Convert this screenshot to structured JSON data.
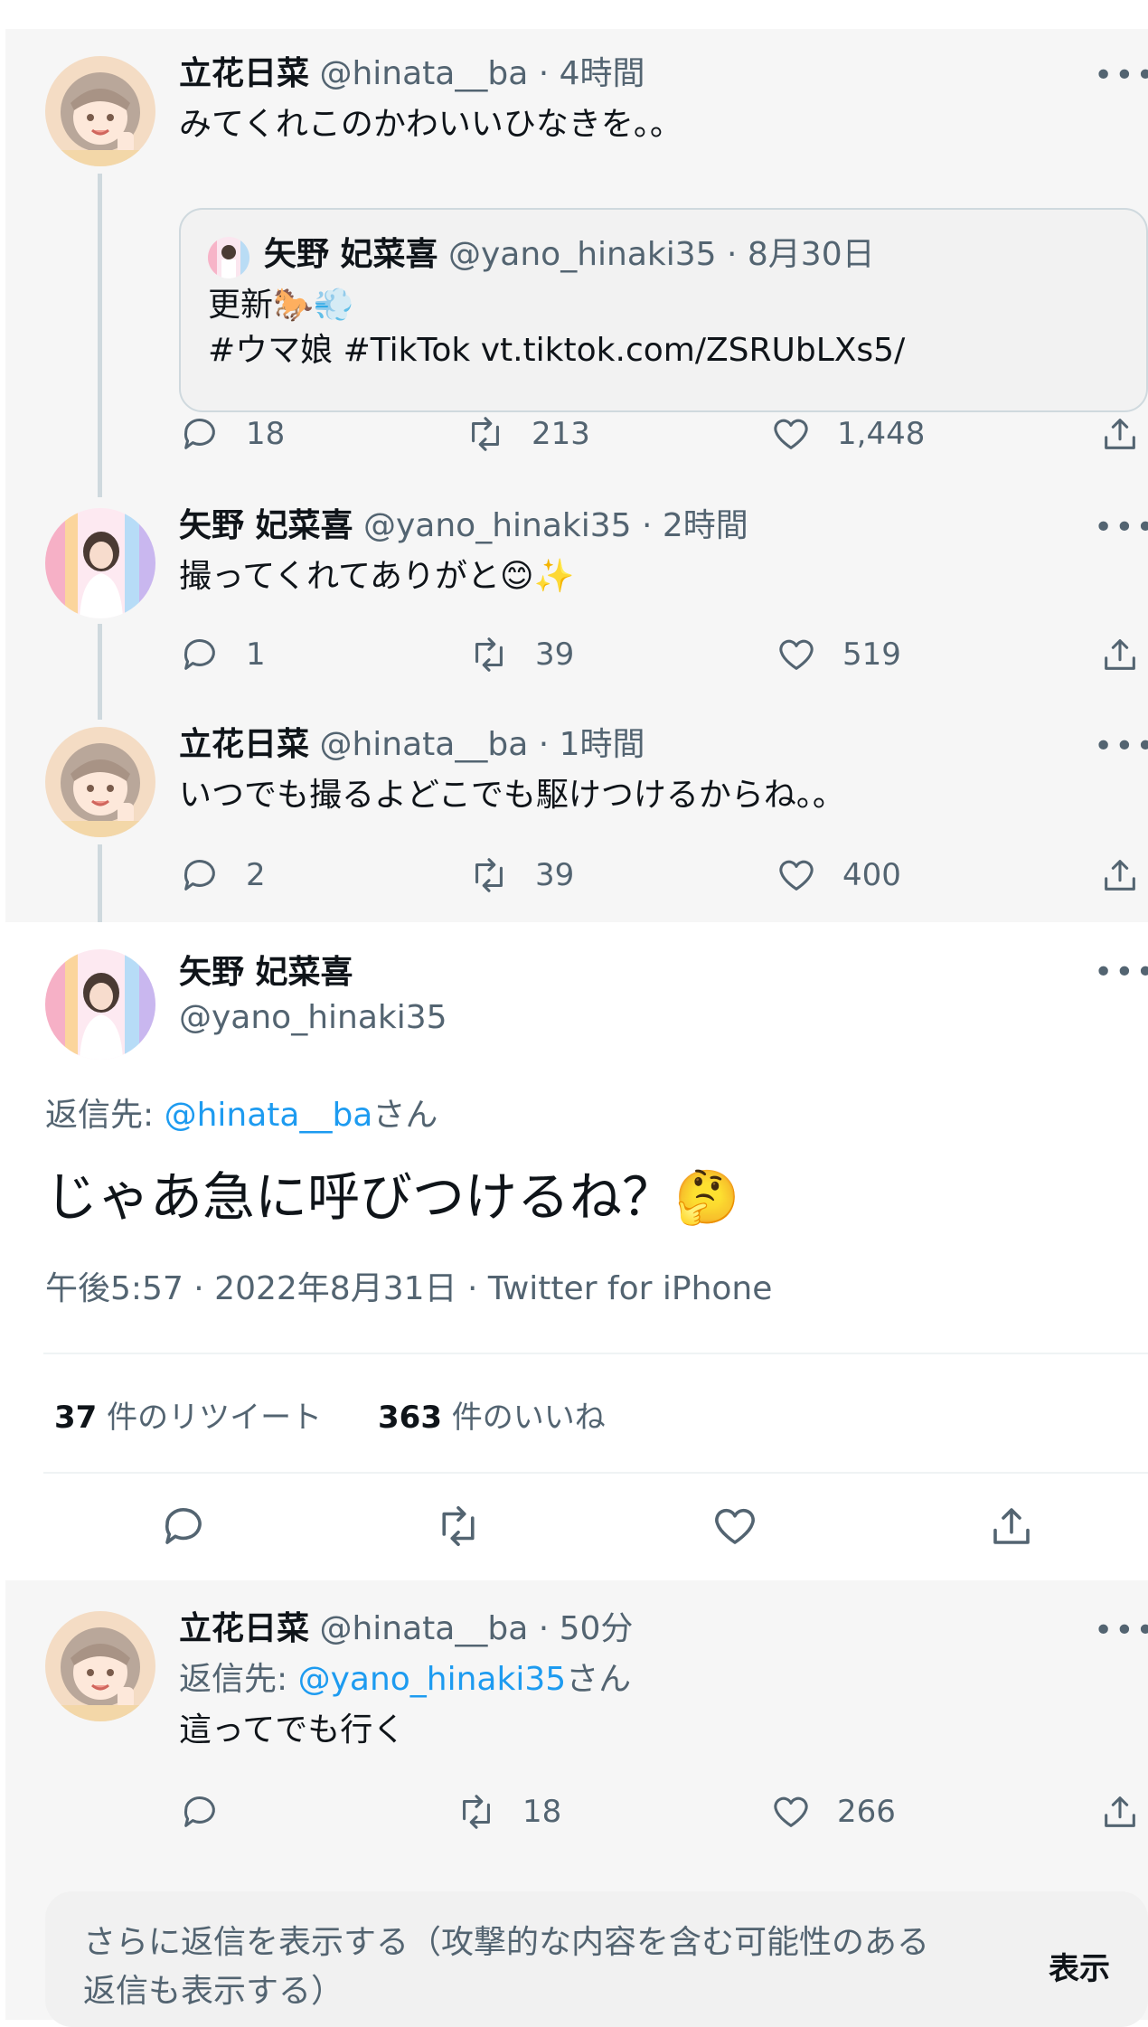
{
  "tweets": [
    {
      "name": "立花日菜",
      "handle": "@hinata__ba",
      "time": "4時間",
      "text": "みてくれこのかわいいひなきを。。",
      "quote": {
        "name": "矢野 妃菜喜",
        "handle": "@yano_hinaki35",
        "time": "8月30日",
        "line1": "更新🐎💨",
        "line2": "#ウマ娘 #TikTok vt.tiktok.com/ZSRUbLXs5/"
      },
      "replies": "18",
      "retweets": "213",
      "likes": "1,448"
    },
    {
      "name": "矢野 妃菜喜",
      "handle": "@yano_hinaki35",
      "time": "2時間",
      "text": "撮ってくれてありがと😊✨",
      "replies": "1",
      "retweets": "39",
      "likes": "519"
    },
    {
      "name": "立花日菜",
      "handle": "@hinata__ba",
      "time": "1時間",
      "text": "いつでも撮るよどこでも駆けつけるからね。。",
      "replies": "2",
      "retweets": "39",
      "likes": "400"
    }
  ],
  "main": {
    "name": "矢野 妃菜喜",
    "handle": "@yano_hinaki35",
    "reply_prefix": "返信先: ",
    "reply_to": "@hinata__ba",
    "reply_suffix": "さん",
    "text": "じゃあ急に呼びつけるね？🤔",
    "meta": "午後5:57 · 2022年8月31日 · Twitter for iPhone",
    "retweets_count": "37",
    "retweets_label": " 件のリツイート",
    "likes_count": "363",
    "likes_label": " 件のいいね"
  },
  "reply": {
    "name": "立花日菜",
    "handle": "@hinata__ba",
    "time": "50分",
    "reply_prefix": "返信先: ",
    "reply_to": "@yano_hinaki35",
    "reply_suffix": "さん",
    "text": "這ってでも行く",
    "replies": "",
    "retweets": "18",
    "likes": "266"
  },
  "more_replies": {
    "line1": "さらに返信を表示する（攻撃的な内容を含む可能性のある",
    "line2": "返信も表示する）",
    "button": "表示"
  },
  "misc": {
    "dot": " · ",
    "more": "•••"
  },
  "colors": {
    "accent": "#1d9bf0",
    "muted": "#536471",
    "text": "#0f1419",
    "thread_line": "#cfd9de"
  }
}
